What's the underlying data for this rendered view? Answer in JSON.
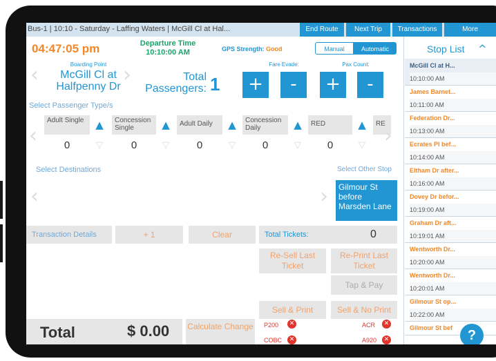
{
  "topbar": {
    "crumb": "Bus-1 | 10:10 - Saturday - Laffing Waters | McGill Cl at Hal...",
    "buttons": [
      "End Route",
      "Next Trip",
      "Transactions",
      "More"
    ]
  },
  "header": {
    "clock": "04:47:05 pm",
    "departure_label": "Departure Time",
    "departure_time": "10:10:00 AM",
    "gps_label": "GPS Strength:",
    "gps_value": "Good",
    "mode_options": [
      "Manual",
      "Automatic"
    ],
    "mode_selected": "Automatic"
  },
  "boarding": {
    "label": "Boarding Point",
    "name": "McGill Cl at Halfpenny Dr",
    "total_label": "Total Passengers:",
    "total_value": "1",
    "fare_evade_label": "Fare Evade:",
    "pax_count_label": "Pax Count:",
    "plus": "+",
    "minus": "-"
  },
  "passenger_types": {
    "label": "Select Passenger Type/s",
    "items": [
      {
        "name": "Adult Single",
        "count": "0"
      },
      {
        "name": "Concession Single",
        "count": "0"
      },
      {
        "name": "Adult Daily",
        "count": "0"
      },
      {
        "name": "Concession Daily",
        "count": "0"
      },
      {
        "name": "RED",
        "count": "0"
      },
      {
        "name": "RE",
        "count": ""
      }
    ]
  },
  "destinations": {
    "label": "Select Destinations",
    "other_stop_label": "Select Other Stop",
    "other_stop_name": "Gilmour St before Marsden Lane"
  },
  "transaction": {
    "details_label": "Transaction Details",
    "plus_one": "+ 1",
    "clear": "Clear",
    "total_tickets_label": "Total Tickets:",
    "total_tickets_value": "0",
    "resell": "Re-Sell Last Ticket",
    "reprint": "Re-Print Last Ticket",
    "tap_pay": "Tap & Pay",
    "sell_print": "Sell & Print",
    "sell_no_print": "Sell & No Print",
    "total_label": "Total",
    "total_value": "$ 0.00",
    "calc_change": "Calculate Change",
    "codes": [
      "P200",
      "ACR",
      "COBC",
      "A920"
    ]
  },
  "stop_list": {
    "title": "Stop List",
    "items": [
      {
        "name": "McGill Cl at H...",
        "time": "10:10:00 AM",
        "current": true
      },
      {
        "name": "James Barnet...",
        "time": "10:11:00 AM"
      },
      {
        "name": "Federation Dr...",
        "time": "10:13:00 AM"
      },
      {
        "name": "Ecrates Pl bef...",
        "time": "10:14:00 AM"
      },
      {
        "name": "Eltham Dr after...",
        "time": "10:16:00 AM"
      },
      {
        "name": "Dovey Dr befor...",
        "time": "10:19:00 AM"
      },
      {
        "name": "Graham Dr aft...",
        "time": "10:19:01 AM"
      },
      {
        "name": "Wentworth Dr...",
        "time": "10:20:00 AM"
      },
      {
        "name": "Wentworth Dr...",
        "time": "10:20:01 AM"
      },
      {
        "name": "Gilmour St op...",
        "time": "10:22:00 AM"
      },
      {
        "name": "Gilmour St bef",
        "time": ""
      }
    ]
  },
  "help": "?",
  "colors": {
    "accent_blue": "#2196d3",
    "orange": "#f0882a",
    "green": "#1aa36a",
    "gray": "#e6e6e6"
  }
}
